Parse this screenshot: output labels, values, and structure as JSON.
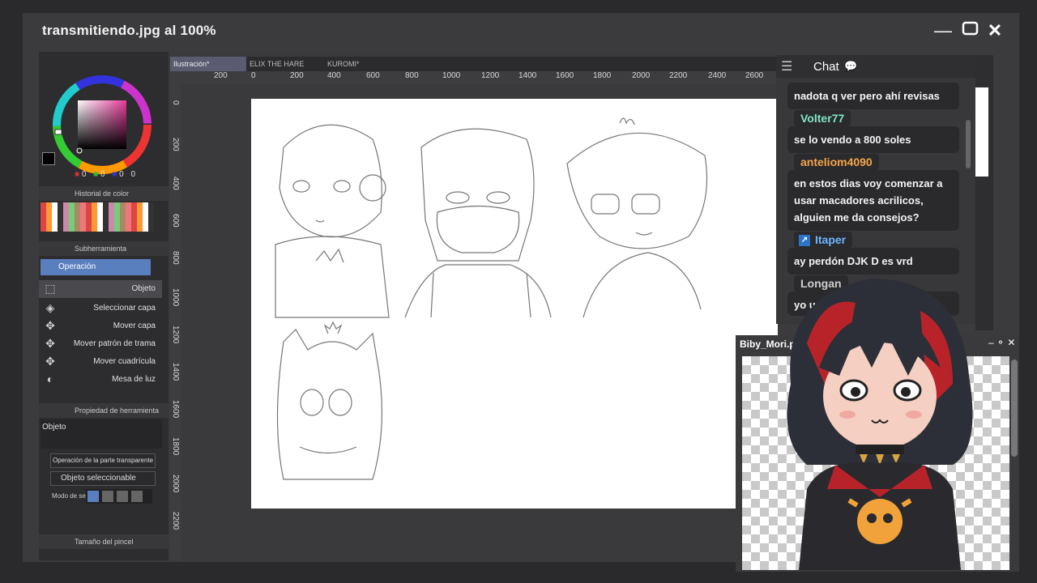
{
  "window": {
    "title": "transmitiendo.jpg al 100%"
  },
  "left_panel": {
    "color_history_label": "Historial de color",
    "color_values": [
      "0",
      "0",
      "0",
      "0"
    ],
    "subtool_label": "Subherramienta",
    "subtool_group": "Operación",
    "tools": [
      {
        "label": "Objeto",
        "icon": "object-select-icon"
      },
      {
        "label": "Seleccionar capa",
        "icon": "layer-select-icon"
      },
      {
        "label": "Mover capa",
        "icon": "move-icon"
      },
      {
        "label": "Mover patrón de trama",
        "icon": "move-icon"
      },
      {
        "label": "Mover cuadrícula",
        "icon": "move-icon"
      },
      {
        "label": "Mesa de luz",
        "icon": "lightbox-icon"
      }
    ],
    "tool_property_label": "Propiedad de herramienta",
    "tool_property_name": "Objeto",
    "dropdown1": "Operación de la parte transparente",
    "dropdown2": "Objeto seleccionable",
    "mode_label": "Modo de se",
    "brush_size_label": "Tamaño del pincel"
  },
  "canvas": {
    "tabs": [
      "Ilustración*",
      "ELIX THE HARE",
      "KUROMI*"
    ],
    "ruler_h": [
      "200",
      "0",
      "200",
      "400",
      "600",
      "800",
      "1000",
      "1200",
      "1400",
      "1600",
      "1800",
      "2000",
      "2200",
      "2400",
      "2600"
    ],
    "ruler_v": [
      "0",
      "200",
      "400",
      "600",
      "800",
      "1000",
      "1200",
      "1400",
      "1600",
      "1800",
      "2000",
      "2200"
    ]
  },
  "chat": {
    "title": "Chat",
    "messages": [
      {
        "user": "",
        "text": "nadota q ver pero ahí revisas"
      },
      {
        "user": "Volter77",
        "color": "#7fe7c4",
        "text": "se lo vendo a 800 soles"
      },
      {
        "user": "anteliom4090",
        "color": "#f5a64a",
        "text": "en estos dias voy comenzar a usar macadores acrilicos, alguien me da consejos?"
      },
      {
        "user": "Itaper",
        "color": "#6fb7ff",
        "text": "ay perdón DJK    D es vrd"
      },
      {
        "user": "Longan",
        "color": "#cfcfcf",
        "text": "yo u"
      }
    ]
  },
  "vtuber": {
    "title": "Biby_Mori.p"
  },
  "colors": {
    "accent": "#5a7fbf",
    "hair_dark": "#2d2f38",
    "hair_red": "#b8232a",
    "shirt_orange": "#f2a23a"
  }
}
